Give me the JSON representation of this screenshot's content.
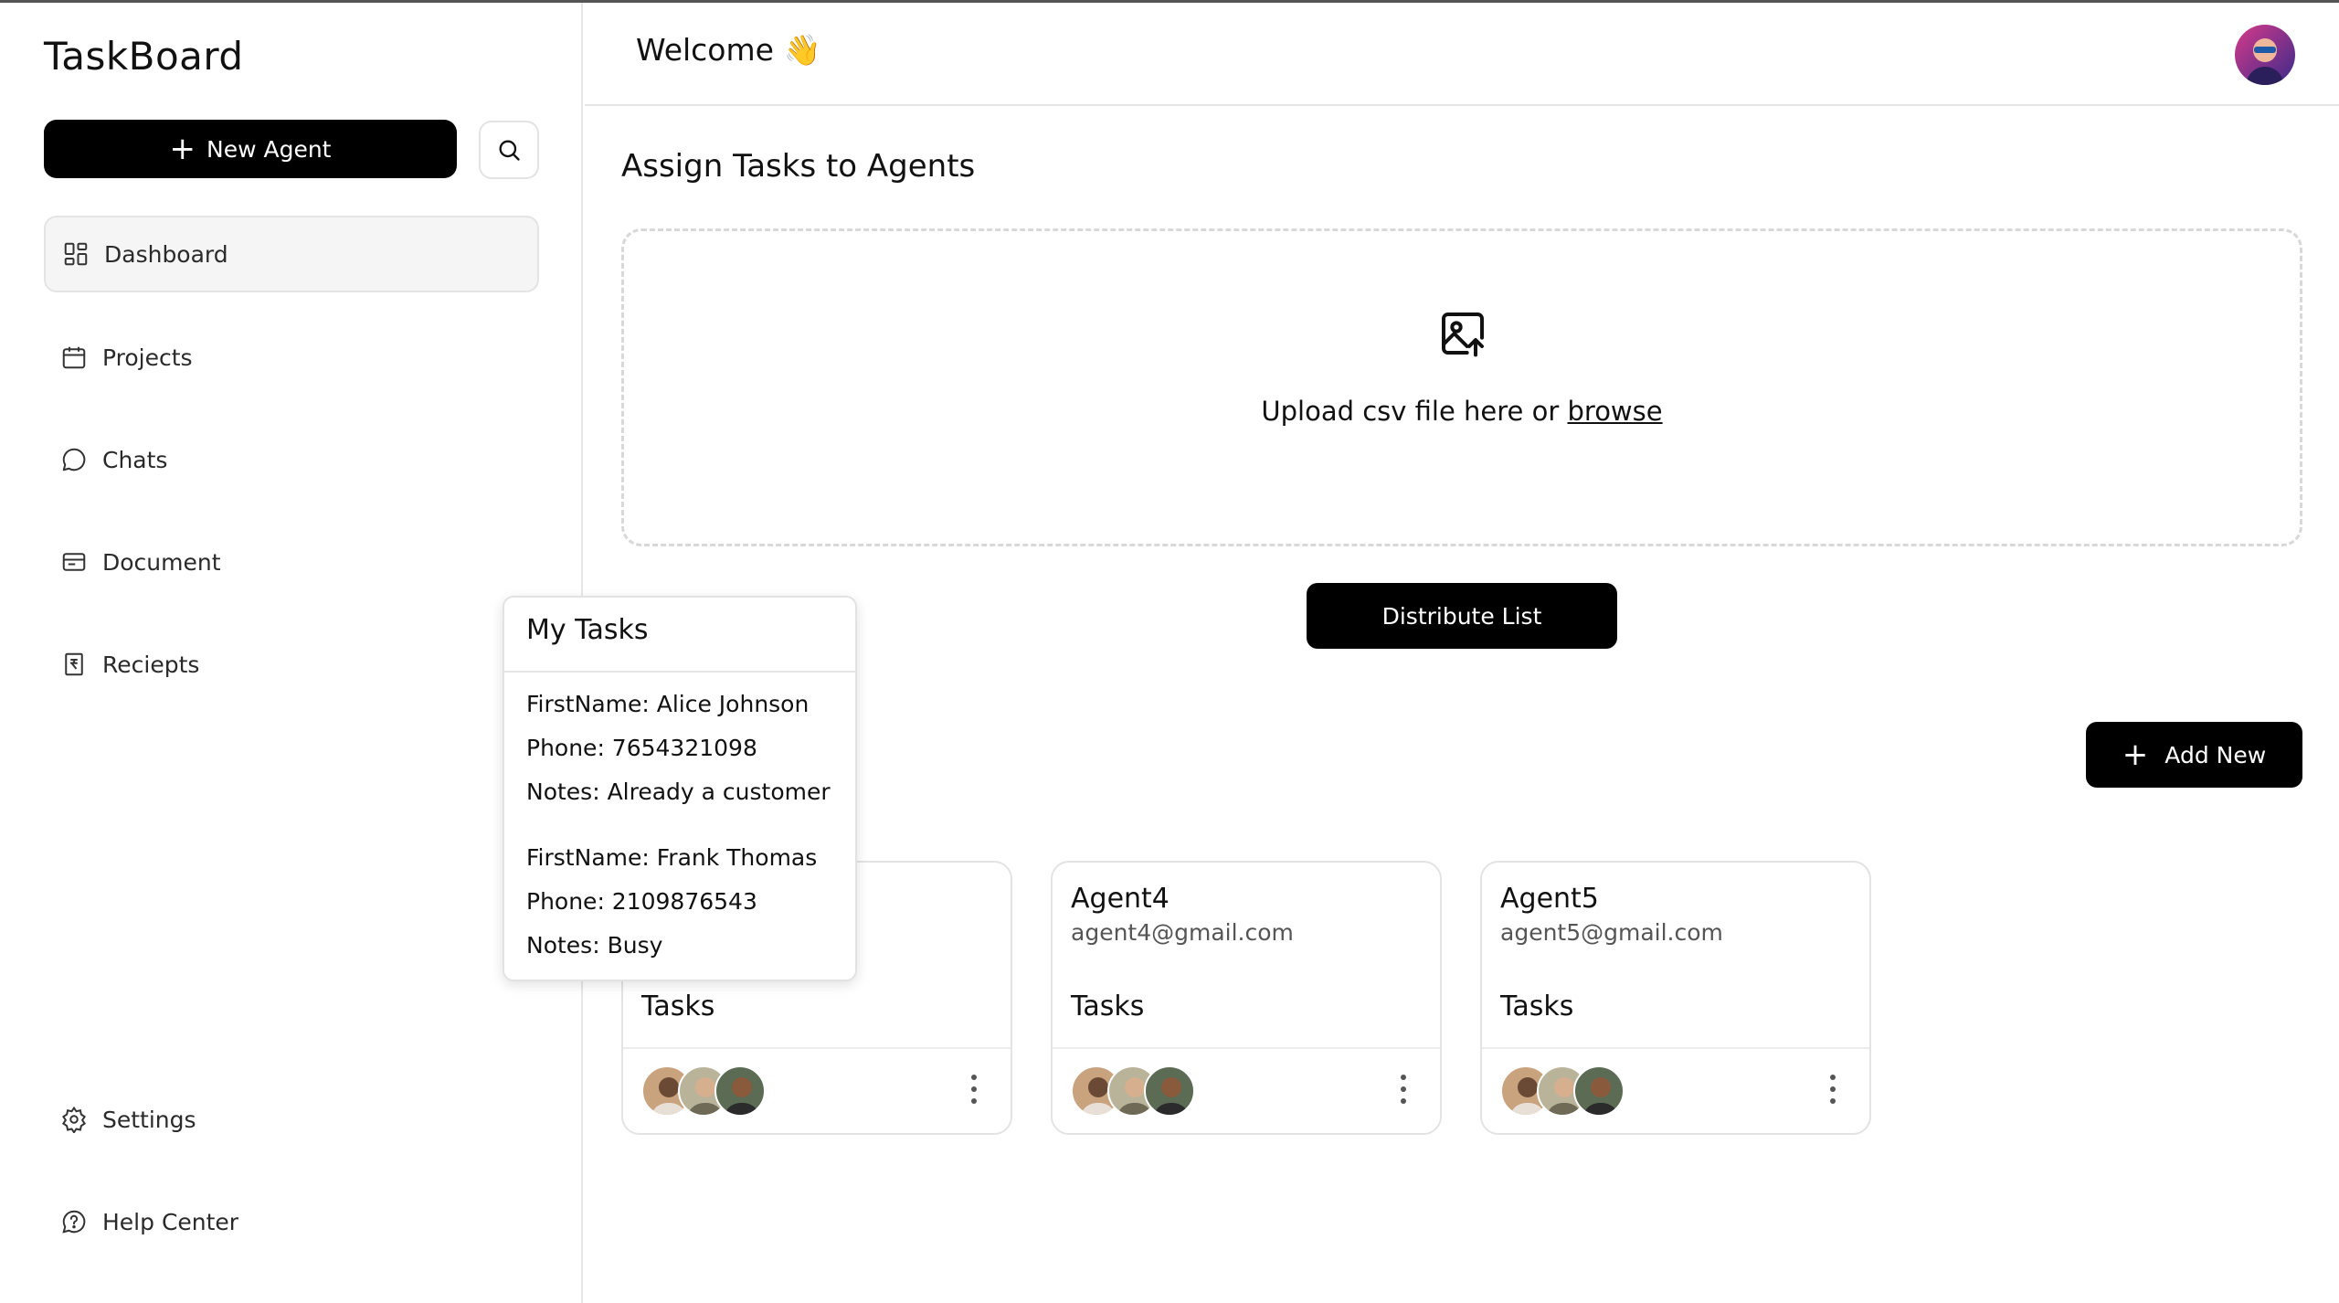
{
  "app": {
    "logo": "TaskBoard"
  },
  "sidebar": {
    "new_agent_label": "New Agent",
    "items": [
      {
        "label": "Dashboard",
        "icon": "grid-icon",
        "active": true
      },
      {
        "label": "Projects",
        "icon": "calendar-icon"
      },
      {
        "label": "Chats",
        "icon": "chat-bubble-icon"
      },
      {
        "label": "Document",
        "icon": "document-icon"
      },
      {
        "label": "Reciepts",
        "icon": "receipt-icon"
      }
    ],
    "bottom_items": [
      {
        "label": "Settings",
        "icon": "gear-icon"
      },
      {
        "label": "Help Center",
        "icon": "help-icon"
      }
    ]
  },
  "header": {
    "welcome": "Welcome 👋"
  },
  "main": {
    "section_title": "Assign Tasks to Agents",
    "upload_text": "Upload csv file here or",
    "browse_label": "browse",
    "distribute_label": "Distribute List",
    "add_new_label": "Add New"
  },
  "cards": [
    {
      "name": "",
      "email": "",
      "tasks_label": "Tasks"
    },
    {
      "name": "Agent4",
      "email": "agent4@gmail.com",
      "tasks_label": "Tasks"
    },
    {
      "name": "Agent5",
      "email": "agent5@gmail.com",
      "tasks_label": "Tasks"
    }
  ],
  "popover": {
    "title": "My Tasks",
    "entries": [
      {
        "first_name": "FirstName: Alice Johnson",
        "phone": "Phone: 7654321098",
        "notes": "Notes: Already a customer"
      },
      {
        "first_name": "FirstName: Frank Thomas",
        "phone": "Phone: 2109876543",
        "notes": "Notes: Busy"
      }
    ]
  }
}
